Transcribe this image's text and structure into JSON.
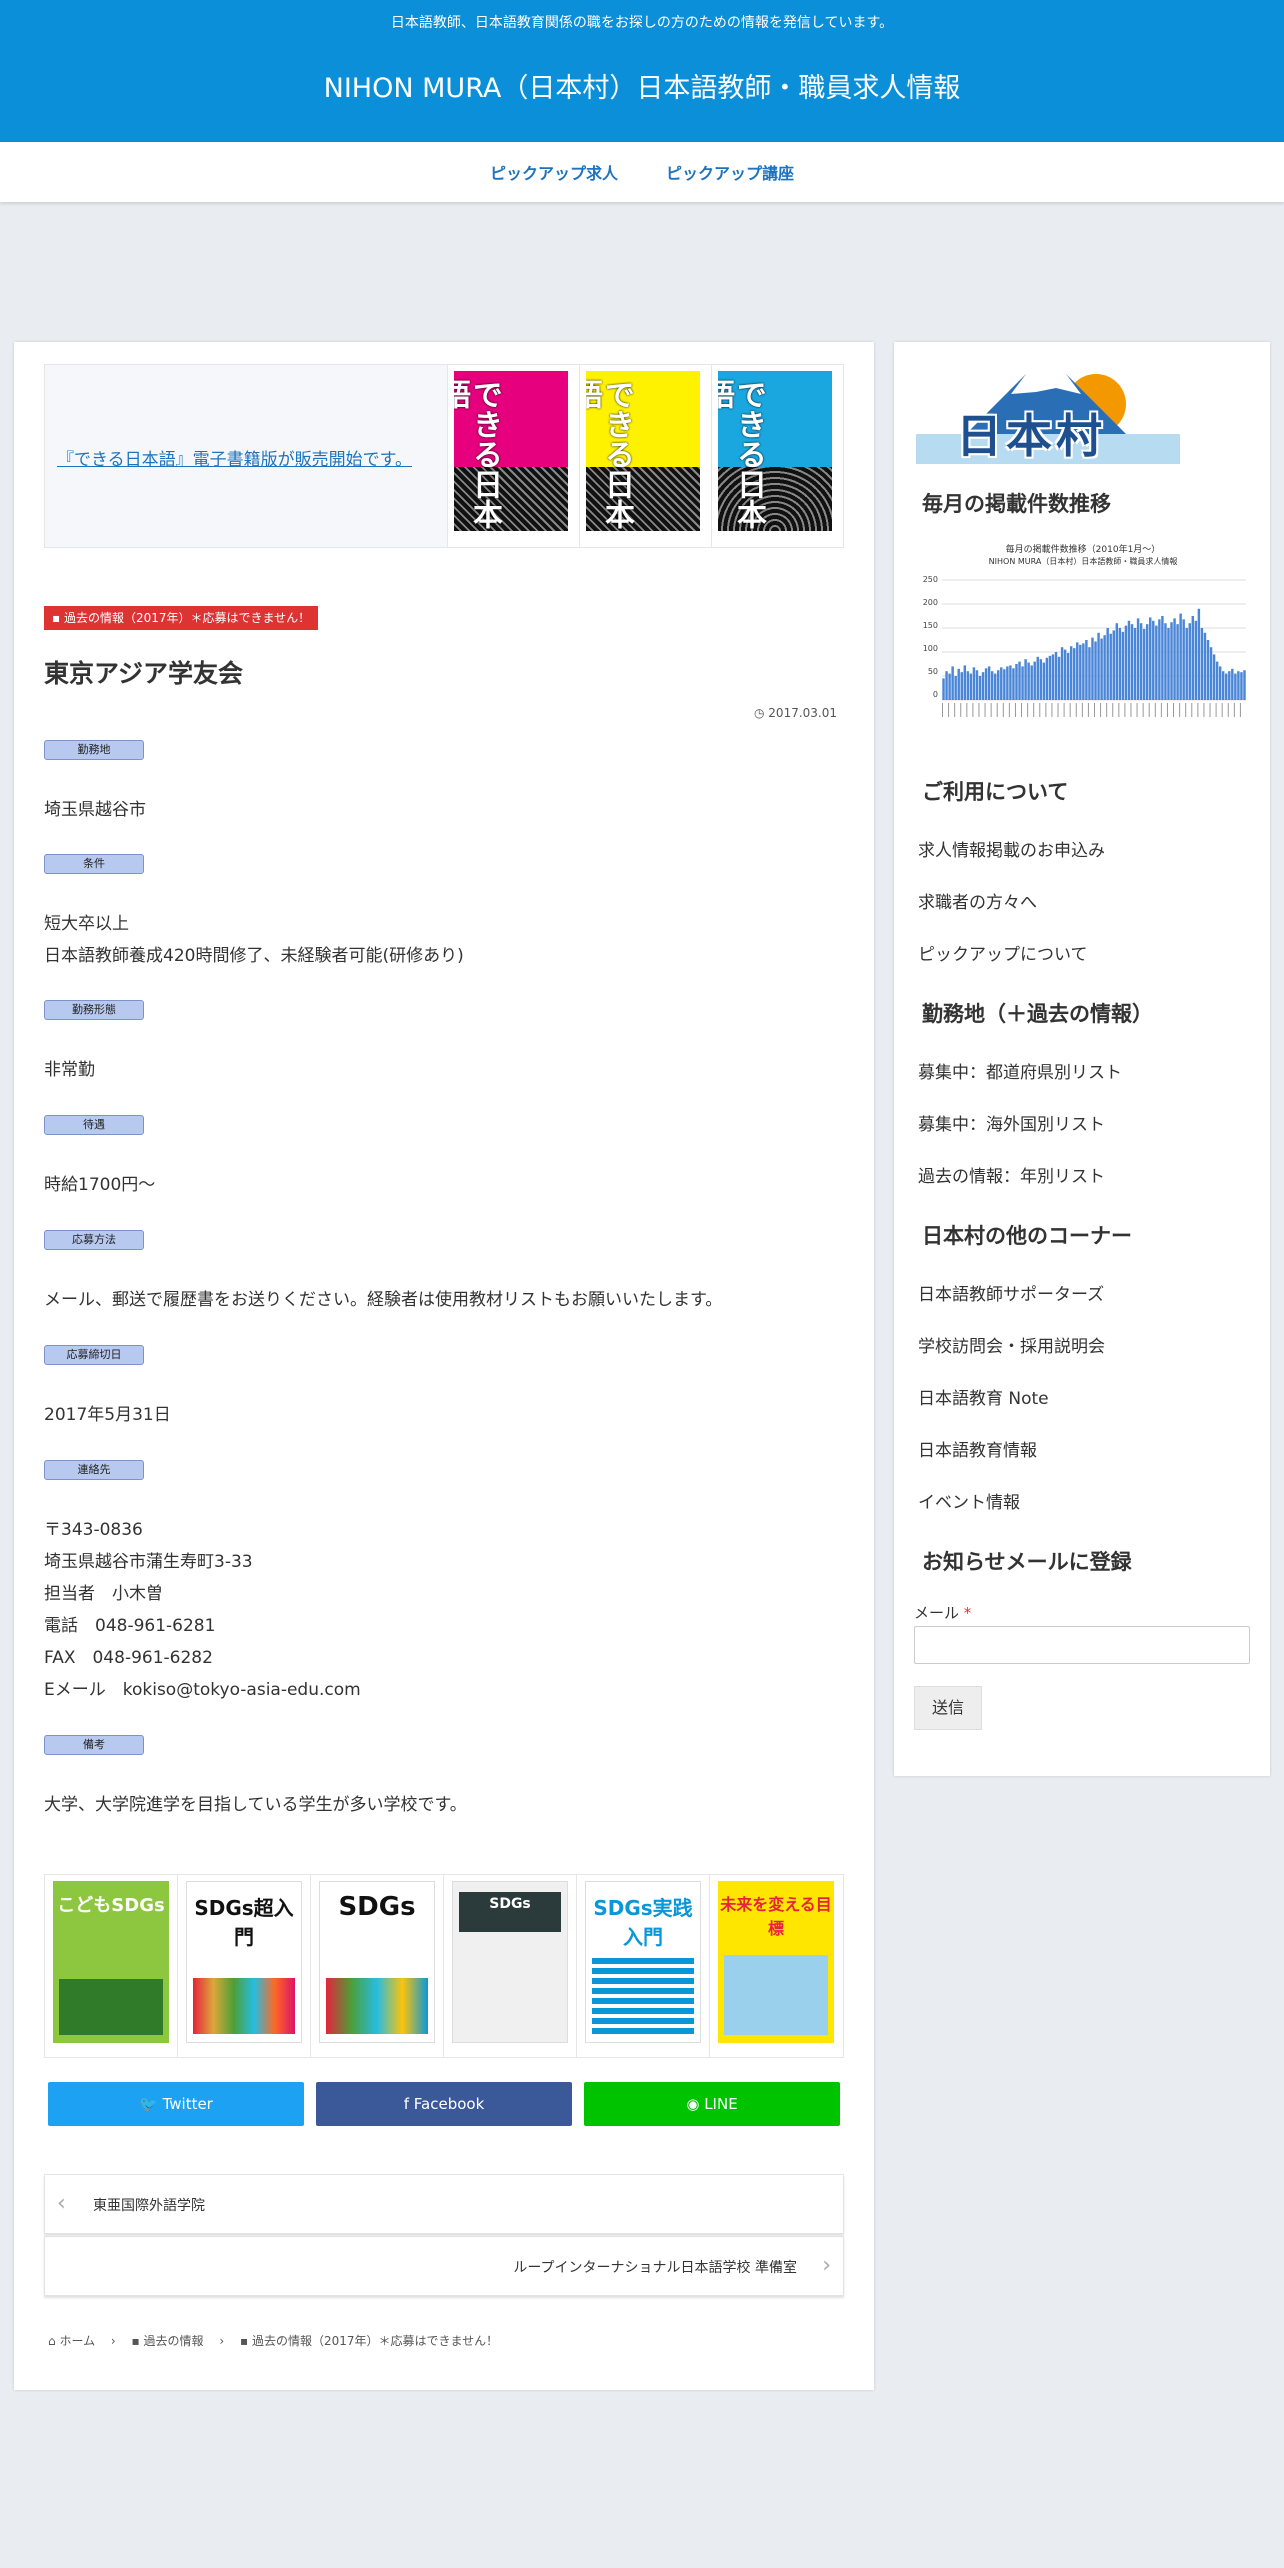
{
  "header": {
    "tagline": "日本語教師、日本語教育関係の職をお探しの方のための情報を発信しています。",
    "site_title": "NIHON MURA（日本村）日本語教師・職員求人情報"
  },
  "nav": {
    "items": [
      "ピックアップ求人",
      "ピックアップ講座"
    ]
  },
  "promo": {
    "link_text": "『できる日本語』電子書籍版が販売開始です。",
    "books": [
      {
        "title": "できる日本語",
        "color": "#e6007e"
      },
      {
        "title": "できる日本語",
        "color": "#fff200"
      },
      {
        "title": "できる日本語",
        "color": "#1aa7e0"
      }
    ]
  },
  "post": {
    "category": "過去の情報（2017年）＊応募はできません！",
    "title": "東京アジア学友会",
    "date": "2017.03.01",
    "sections": [
      {
        "label": "勤務地",
        "lines": [
          "埼玉県越谷市"
        ]
      },
      {
        "label": "条件",
        "lines": [
          "短大卒以上",
          "日本語教師養成420時間修了、未経験者可能(研修あり)"
        ]
      },
      {
        "label": "勤務形態",
        "lines": [
          "非常勤"
        ]
      },
      {
        "label": "待遇",
        "lines": [
          "時給1700円～"
        ]
      },
      {
        "label": "応募方法",
        "lines": [
          "メール、郵送で履歴書をお送りください。経験者は使用教材リストもお願いいたします。"
        ]
      },
      {
        "label": "応募締切日",
        "lines": [
          "2017年5月31日"
        ]
      },
      {
        "label": "連絡先",
        "lines": [
          "〒343-0836",
          "埼玉県越谷市蒲生寿町3-33",
          "担当者　小木曽",
          "電話　048-961-6281",
          "FAX　048-961-6282",
          "Eメール　kokiso@tokyo-asia-edu.com"
        ]
      },
      {
        "label": "備考",
        "lines": [
          "大学、大学院進学を目指している学生が多い学校です。"
        ]
      }
    ]
  },
  "sdg_books": [
    {
      "title": "こどもSDGs",
      "color": "#8dc63f"
    },
    {
      "title": "SDGs超入門",
      "color": "#ffffff"
    },
    {
      "title": "SDGs",
      "color": "#ffffff"
    },
    {
      "title": "SDGs",
      "color": "#f0f0f0"
    },
    {
      "title": "SDGs実践入門",
      "color": "#ffffff"
    },
    {
      "title": "未来を変える目標",
      "color": "#ffe600"
    }
  ],
  "share": {
    "twitter": "Twitter",
    "facebook": "Facebook",
    "line": "LINE"
  },
  "post_nav": {
    "prev": "東亜国際外語学院",
    "next": "ループインターナショナル日本語学校 準備室"
  },
  "breadcrumb": {
    "home": "ホーム",
    "cat1": "過去の情報",
    "cat2": "過去の情報（2017年）＊応募はできません！"
  },
  "sidebar": {
    "logo_text": "日本村",
    "chart_heading": "毎月の掲載件数推移",
    "chart_title": "毎月の掲載件数推移（2010年1月～）",
    "chart_subtitle": "NIHON MURA（日本村）日本語教師・職員求人情報",
    "chart_ticks": [
      "250",
      "200",
      "150",
      "100",
      "50",
      "0"
    ],
    "usage_heading": "ご利用について",
    "usage_links": [
      "求人情報掲載のお申込み",
      "求職者の方々へ",
      "ピックアップについて"
    ],
    "location_heading": "勤務地（＋過去の情報）",
    "location_links": [
      "募集中：都道府県別リスト",
      "募集中：海外国別リスト",
      "過去の情報：年別リスト"
    ],
    "other_heading": "日本村の他のコーナー",
    "other_links": [
      "日本語教師サポーターズ",
      "学校訪問会・採用説明会",
      "日本語教育 Note",
      "日本語教育情報",
      "イベント情報"
    ],
    "mail_heading": "お知らせメールに登録",
    "mail_label": "メール",
    "required_mark": "*",
    "submit": "送信"
  },
  "chart_data": {
    "type": "bar",
    "title": "毎月の掲載件数推移（2010年1月～）",
    "subtitle": "NIHON MURA（日本村）日本語教師・職員求人情報",
    "ylim": [
      0,
      250
    ],
    "yticks": [
      0,
      50,
      100,
      150,
      200,
      250
    ],
    "values": [
      45,
      60,
      55,
      70,
      50,
      65,
      58,
      72,
      60,
      55,
      68,
      62,
      50,
      58,
      66,
      70,
      60,
      55,
      62,
      68,
      64,
      70,
      72,
      66,
      75,
      80,
      70,
      85,
      78,
      72,
      80,
      90,
      85,
      78,
      88,
      92,
      95,
      100,
      90,
      110,
      105,
      98,
      112,
      108,
      120,
      115,
      118,
      125,
      110,
      130,
      122,
      140,
      128,
      135,
      150,
      138,
      145,
      160,
      150,
      142,
      155,
      165,
      158,
      150,
      170,
      160,
      148,
      158,
      172,
      165,
      155,
      168,
      175,
      160,
      150,
      162,
      170,
      158,
      180,
      168,
      150,
      160,
      175,
      165,
      190,
      150,
      140,
      125,
      110,
      95,
      80,
      70,
      60,
      55,
      60,
      65,
      55,
      60,
      58,
      62
    ]
  }
}
